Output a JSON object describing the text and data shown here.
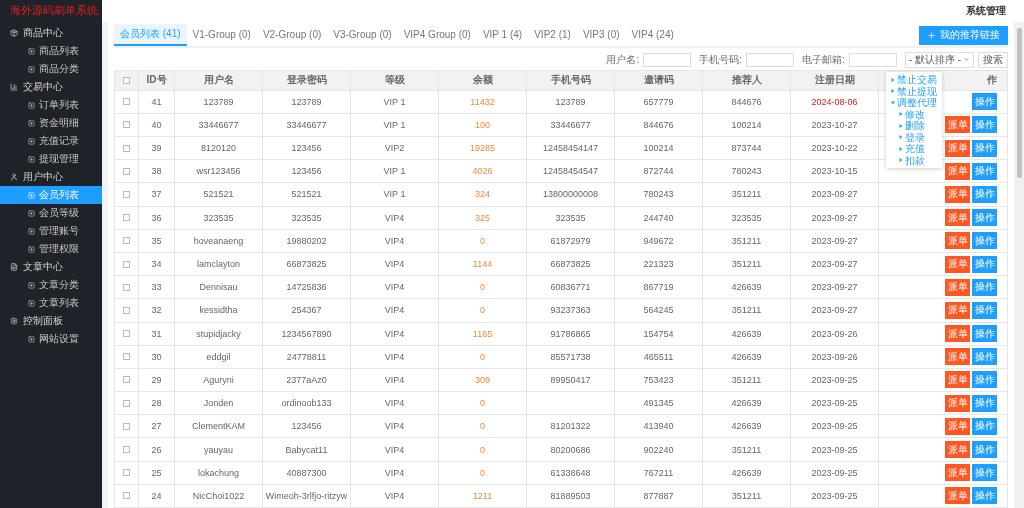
{
  "app_title": "海外源码刷单系统",
  "sidebar": {
    "groups": [
      {
        "label": "商品中心",
        "items": [
          {
            "label": "商品列表",
            "selected": false
          },
          {
            "label": "商品分类",
            "selected": false
          }
        ]
      },
      {
        "label": "交易中心",
        "items": [
          {
            "label": "订单列表",
            "selected": false
          },
          {
            "label": "资金明细",
            "selected": false
          },
          {
            "label": "充值记录",
            "selected": false
          },
          {
            "label": "提现管理",
            "selected": false
          }
        ]
      },
      {
        "label": "用户中心",
        "items": [
          {
            "label": "会员列表",
            "selected": true
          },
          {
            "label": "会员等级",
            "selected": false
          },
          {
            "label": "管理账号",
            "selected": false
          },
          {
            "label": "管理权限",
            "selected": false
          }
        ]
      },
      {
        "label": "文章中心",
        "items": [
          {
            "label": "文章分类",
            "selected": false
          },
          {
            "label": "文章列表",
            "selected": false
          }
        ]
      },
      {
        "label": "控制面板",
        "items": [
          {
            "label": "网站设置",
            "selected": false
          }
        ]
      }
    ]
  },
  "header": {
    "user_menu": "系统管理"
  },
  "tabs": [
    {
      "label": "会员列表 (41)",
      "selected": true
    },
    {
      "label": "V1-Group (0)",
      "selected": false
    },
    {
      "label": "V2-Group (0)",
      "selected": false
    },
    {
      "label": "V3-Group (0)",
      "selected": false
    },
    {
      "label": "VIP4 Group (0)",
      "selected": false
    },
    {
      "label": "VIP 1 (4)",
      "selected": false
    },
    {
      "label": "VIP2 (1)",
      "selected": false
    },
    {
      "label": "VIP3 (0)",
      "selected": false
    },
    {
      "label": "VIP4 (24)",
      "selected": false
    }
  ],
  "add_button": "我的推荐链接",
  "filters": {
    "fields": [
      {
        "label": "用户名:"
      },
      {
        "label": "手机号码:"
      },
      {
        "label": "电子邮箱:"
      }
    ],
    "sort_select": "- 默认排序 -",
    "search_button": "搜索"
  },
  "table": {
    "header_checked": false,
    "columns": [
      "ID号",
      "用户名",
      "登录密码",
      "等级",
      "余额",
      "手机号码",
      "邀请码",
      "推荐人",
      "注册日期",
      "作"
    ],
    "rows": [
      {
        "checked": false,
        "id": "41",
        "username": "123789",
        "password": "123789",
        "level": "VIP 1",
        "balance": "11432",
        "phone": "123789",
        "invite": "657779",
        "referrer": "844676",
        "date": "2024-08-06",
        "date_highlighted": true,
        "actions": [
          {
            "kind": "operate",
            "label": "操作"
          }
        ]
      },
      {
        "checked": false,
        "id": "40",
        "username": "33446677",
        "password": "33446677",
        "level": "VIP 1",
        "balance": "100",
        "phone": "33446677",
        "invite": "844676",
        "referrer": "100214",
        "date": "2023-10-27",
        "date_highlighted": false,
        "actions": [
          {
            "kind": "dispatch",
            "label": "派单"
          },
          {
            "kind": "operate",
            "label": "操作"
          }
        ]
      },
      {
        "checked": false,
        "id": "39",
        "username": "8120120",
        "password": "123456",
        "level": "VIP2",
        "balance": "19285",
        "phone": "12458454147",
        "invite": "100214",
        "referrer": "873744",
        "date": "2023-10-22",
        "date_highlighted": false,
        "actions": [
          {
            "kind": "dispatch",
            "label": "派单"
          },
          {
            "kind": "operate",
            "label": "操作"
          }
        ]
      },
      {
        "checked": false,
        "id": "38",
        "username": "wsr123456",
        "password": "123456",
        "level": "VIP 1",
        "balance": "4026",
        "phone": "12458454547",
        "invite": "872744",
        "referrer": "780243",
        "date": "2023-10-15",
        "date_highlighted": false,
        "actions": [
          {
            "kind": "dispatch",
            "label": "派单"
          },
          {
            "kind": "operate",
            "label": "操作"
          }
        ]
      },
      {
        "checked": false,
        "id": "37",
        "username": "521521",
        "password": "521521",
        "level": "VIP 1",
        "balance": "324",
        "phone": "13800000008",
        "invite": "780243",
        "referrer": "351211",
        "date": "2023-09-27",
        "date_highlighted": false,
        "actions": [
          {
            "kind": "dispatch",
            "label": "派单"
          },
          {
            "kind": "operate",
            "label": "操作"
          }
        ]
      },
      {
        "checked": false,
        "id": "36",
        "username": "323535",
        "password": "323535",
        "level": "VIP4",
        "balance": "325",
        "phone": "323535",
        "invite": "244740",
        "referrer": "323535",
        "date": "2023-09-27",
        "date_highlighted": false,
        "actions": [
          {
            "kind": "dispatch",
            "label": "派单"
          },
          {
            "kind": "operate",
            "label": "操作"
          }
        ]
      },
      {
        "checked": false,
        "id": "35",
        "username": "hoveanaeng",
        "password": "19880202",
        "level": "VIP4",
        "balance": "0",
        "phone": "61872979",
        "invite": "949672",
        "referrer": "351211",
        "date": "2023-09-27",
        "date_highlighted": false,
        "actions": [
          {
            "kind": "dispatch",
            "label": "派单"
          },
          {
            "kind": "operate",
            "label": "操作"
          }
        ]
      },
      {
        "checked": false,
        "id": "34",
        "username": "lamclayton",
        "password": "66873825",
        "level": "VIP4",
        "balance": "1144",
        "phone": "66873825",
        "invite": "221323",
        "referrer": "351211",
        "date": "2023-09-27",
        "date_highlighted": false,
        "actions": [
          {
            "kind": "dispatch",
            "label": "派单"
          },
          {
            "kind": "operate",
            "label": "操作"
          }
        ]
      },
      {
        "checked": false,
        "id": "33",
        "username": "Dennisau",
        "password": "14725836",
        "level": "VIP4",
        "balance": "0",
        "phone": "60836771",
        "invite": "867719",
        "referrer": "426639",
        "date": "2023-09-27",
        "date_highlighted": false,
        "actions": [
          {
            "kind": "dispatch",
            "label": "派单"
          },
          {
            "kind": "operate",
            "label": "操作"
          }
        ]
      },
      {
        "checked": false,
        "id": "32",
        "username": "kessidtha",
        "password": "254367",
        "level": "VIP4",
        "balance": "0",
        "phone": "93237363",
        "invite": "564245",
        "referrer": "351211",
        "date": "2023-09-27",
        "date_highlighted": false,
        "actions": [
          {
            "kind": "dispatch",
            "label": "派单"
          },
          {
            "kind": "operate",
            "label": "操作"
          }
        ]
      },
      {
        "checked": false,
        "id": "31",
        "username": "stupidjacky",
        "password": "1234567890",
        "level": "VIP4",
        "balance": "1165",
        "phone": "91786865",
        "invite": "154754",
        "referrer": "426639",
        "date": "2023-09-26",
        "date_highlighted": false,
        "actions": [
          {
            "kind": "dispatch",
            "label": "派单"
          },
          {
            "kind": "operate",
            "label": "操作"
          }
        ]
      },
      {
        "checked": false,
        "id": "30",
        "username": "eddgil",
        "password": "24778811",
        "level": "VIP4",
        "balance": "0",
        "phone": "85571738",
        "invite": "465511",
        "referrer": "426639",
        "date": "2023-09-26",
        "date_highlighted": false,
        "actions": [
          {
            "kind": "dispatch",
            "label": "派单"
          },
          {
            "kind": "operate",
            "label": "操作"
          }
        ]
      },
      {
        "checked": false,
        "id": "29",
        "username": "Aguryni",
        "password": "2377aAz0",
        "level": "VIP4",
        "balance": "309",
        "phone": "89950417",
        "invite": "753423",
        "referrer": "351211",
        "date": "2023-09-25",
        "date_highlighted": false,
        "actions": [
          {
            "kind": "dispatch",
            "label": "派单"
          },
          {
            "kind": "operate",
            "label": "操作"
          }
        ]
      },
      {
        "checked": false,
        "id": "28",
        "username": "Jonden",
        "password": "ordinoob133",
        "level": "VIP4",
        "balance": "0",
        "invite": "491345",
        "referrer": "426639",
        "date": "2023-09-25",
        "date_highlighted": false,
        "actions": [
          {
            "kind": "dispatch",
            "label": "派单"
          },
          {
            "kind": "operate",
            "label": "操作"
          }
        ]
      },
      {
        "checked": false,
        "id": "27",
        "username": "ClementKAM",
        "password": "123456",
        "level": "VIP4",
        "balance": "0",
        "phone": "81201322",
        "invite": "413940",
        "referrer": "426639",
        "date": "2023-09-25",
        "date_highlighted": false,
        "actions": [
          {
            "kind": "dispatch",
            "label": "派单"
          },
          {
            "kind": "operate",
            "label": "操作"
          }
        ]
      },
      {
        "checked": false,
        "id": "26",
        "username": "yauyau",
        "password": "Babycat11",
        "level": "VIP4",
        "balance": "0",
        "phone": "80200686",
        "invite": "902240",
        "referrer": "351211",
        "date": "2023-09-25",
        "date_highlighted": false,
        "actions": [
          {
            "kind": "dispatch",
            "label": "派单"
          },
          {
            "kind": "operate",
            "label": "操作"
          }
        ]
      },
      {
        "checked": false,
        "id": "25",
        "username": "lokachung",
        "password": "40887300",
        "level": "VIP4",
        "balance": "0",
        "phone": "61338648",
        "invite": "767211",
        "referrer": "426639",
        "date": "2023-09-25",
        "date_highlighted": false,
        "actions": [
          {
            "kind": "dispatch",
            "label": "派单"
          },
          {
            "kind": "operate",
            "label": "操作"
          }
        ]
      },
      {
        "checked": false,
        "id": "24",
        "username": "NicChoi1022",
        "password": "Wimeoh-3rlfjo-ritzyw",
        "level": "VIP4",
        "balance": "1211",
        "phone": "81889503",
        "invite": "877887",
        "referrer": "351211",
        "date": "2023-09-25",
        "date_highlighted": false,
        "actions": [
          {
            "kind": "dispatch",
            "label": "派单"
          },
          {
            "kind": "operate",
            "label": "操作"
          }
        ]
      }
    ]
  },
  "action_menu": {
    "items": [
      {
        "label": "禁止交易"
      },
      {
        "label": "禁止提现"
      },
      {
        "label": "调整代理",
        "expanded": true,
        "children": [
          {
            "label": "修改"
          },
          {
            "label": "删除"
          },
          {
            "label": "登录"
          },
          {
            "label": "充值"
          },
          {
            "label": "扣款"
          }
        ]
      }
    ]
  }
}
